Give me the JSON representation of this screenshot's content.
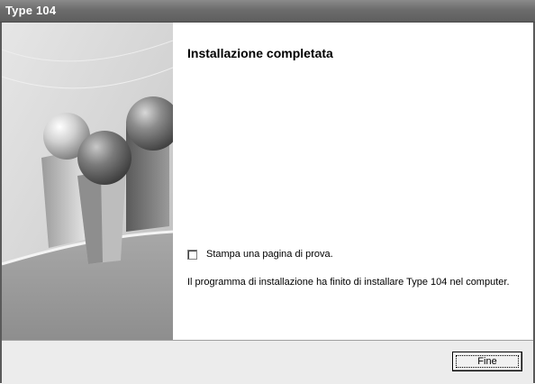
{
  "window": {
    "title": "Type 104"
  },
  "main": {
    "heading": "Installazione completata",
    "checkbox_label": "Stampa una pagina di prova.",
    "checkbox_checked": false,
    "info_text": "Il programma di installazione ha finito di installare Type 104 nel computer."
  },
  "footer": {
    "finish_label": "Fine"
  },
  "colors": {
    "titlebar": "#6c6c6c",
    "side_panel": "#d8d8d8",
    "footer": "#ececec"
  },
  "icons": [
    "illustration-spheres",
    "checkbox"
  ]
}
